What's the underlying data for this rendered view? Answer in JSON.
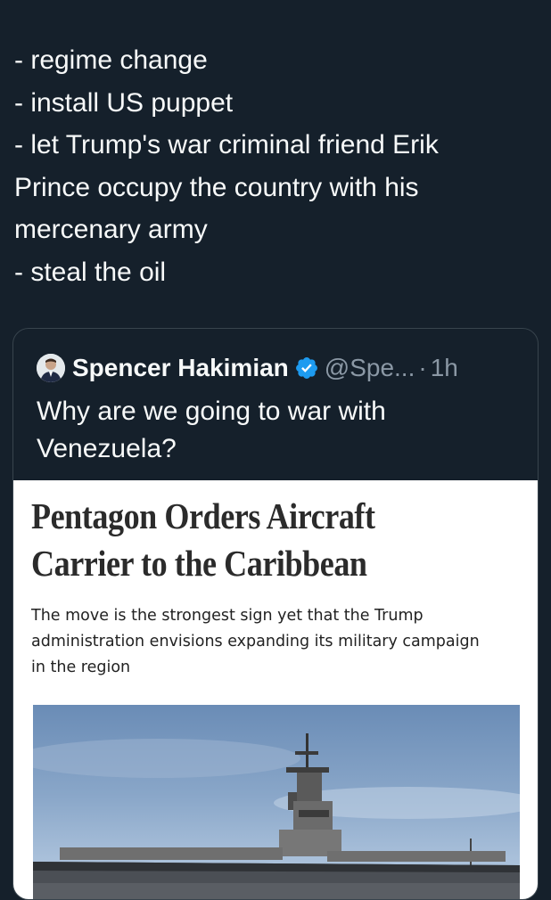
{
  "tweet": {
    "lines": [
      "- regime change",
      "- install US puppet",
      "- let Trump's war criminal friend Erik",
      "Prince occupy the country with his",
      "mercenary army",
      "- steal the oil"
    ]
  },
  "quoted_tweet": {
    "display_name": "Spencer Hakimian",
    "handle": "@Spe...",
    "separator": "·",
    "time": "1h",
    "text_lines": [
      "Why are we going to war with",
      "Venezuela?"
    ],
    "verified_color": "#1d9bf0",
    "article": {
      "headline_lines": [
        "Pentagon Orders Aircraft",
        "Carrier to the Caribbean"
      ],
      "dek_lines": [
        "The move is the strongest sign yet that the Trump",
        "administration envisions expanding its military campaign",
        "in the region"
      ]
    }
  }
}
